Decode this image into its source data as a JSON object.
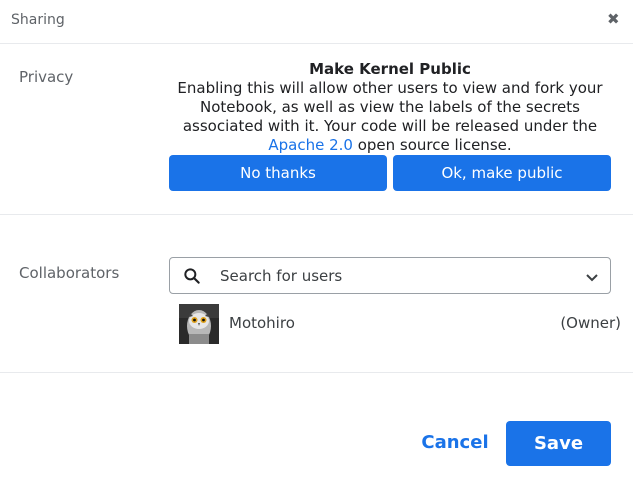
{
  "dialog": {
    "title": "Sharing",
    "close_icon": "close-icon"
  },
  "privacy": {
    "section_label": "Privacy",
    "heading": "Make Kernel Public",
    "text_before_link": "Enabling this will allow other users to view and fork your Notebook, as well as view the labels of the secrets associated with it. Your code will be released under the",
    "link_text": "Apache 2.0",
    "text_after_link": "open source license.",
    "no_thanks_label": "No thanks",
    "make_public_label": "Ok, make public"
  },
  "collaborators": {
    "section_label": "Collaborators",
    "search_placeholder": "Search for users",
    "search_icon": "search-icon",
    "dropdown_icon": "chevron-down-icon",
    "users": [
      {
        "name": "Motohiro",
        "role": "(Owner)",
        "avatar": "owl-avatar"
      }
    ]
  },
  "footer": {
    "cancel_label": "Cancel",
    "save_label": "Save"
  },
  "colors": {
    "accent": "#1a73e8",
    "label_gray": "#5f6368",
    "divider": "#e8eaed"
  }
}
